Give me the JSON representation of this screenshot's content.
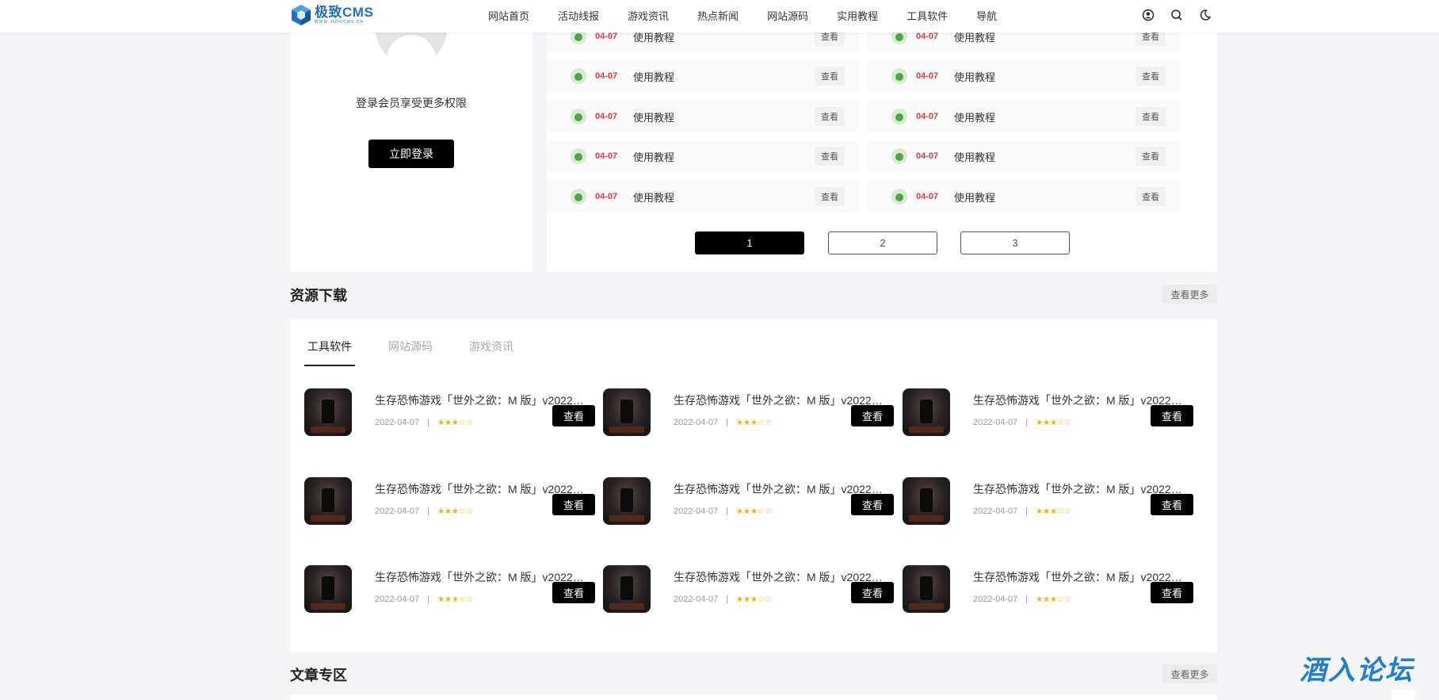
{
  "header": {
    "logo_name": "极致CMS",
    "logo_sub": "WWW.JIZHICMS.CN",
    "nav": [
      "网站首页",
      "活动线报",
      "游戏资讯",
      "热点新闻",
      "网站源码",
      "实用教程",
      "工具软件",
      "导航"
    ],
    "icons": [
      "user-icon",
      "search-icon",
      "moon-icon"
    ]
  },
  "login": {
    "text": "登录会员享受更多权限",
    "button": "立即登录"
  },
  "list": {
    "rows": [
      {
        "date": "04-07",
        "title": "使用教程",
        "view": "查看"
      },
      {
        "date": "04-07",
        "title": "使用教程",
        "view": "查看"
      },
      {
        "date": "04-07",
        "title": "使用教程",
        "view": "查看"
      },
      {
        "date": "04-07",
        "title": "使用教程",
        "view": "查看"
      },
      {
        "date": "04-07",
        "title": "使用教程",
        "view": "查看"
      },
      {
        "date": "04-07",
        "title": "使用教程",
        "view": "查看"
      },
      {
        "date": "04-07",
        "title": "使用教程",
        "view": "查看"
      },
      {
        "date": "04-07",
        "title": "使用教程",
        "view": "查看"
      },
      {
        "date": "04-07",
        "title": "使用教程",
        "view": "查看"
      },
      {
        "date": "04-07",
        "title": "使用教程",
        "view": "查看"
      }
    ],
    "pages": [
      "1",
      "2",
      "3"
    ],
    "current_page": "1"
  },
  "resources": {
    "title": "资源下载",
    "more": "查看更多",
    "tabs": [
      "工具软件",
      "网站源码",
      "游戏资讯"
    ],
    "active_tab": "工具软件",
    "items": [
      {
        "title": "生存恐怖游戏「世外之欲：M 版」v2022021...",
        "date": "2022-04-07",
        "sep": "|",
        "stars": "★★★☆☆",
        "rating": 3,
        "button": "查看"
      },
      {
        "title": "生存恐怖游戏「世外之欲：M 版」v2022021...",
        "date": "2022-04-07",
        "sep": "|",
        "stars": "★★★☆☆",
        "rating": 3,
        "button": "查看"
      },
      {
        "title": "生存恐怖游戏「世外之欲：M 版」v2022021...",
        "date": "2022-04-07",
        "sep": "|",
        "stars": "★★★☆☆",
        "rating": 3,
        "button": "查看"
      },
      {
        "title": "生存恐怖游戏「世外之欲：M 版」v2022021...",
        "date": "2022-04-07",
        "sep": "|",
        "stars": "★★★☆☆",
        "rating": 3,
        "button": "查看"
      },
      {
        "title": "生存恐怖游戏「世外之欲：M 版」v2022021...",
        "date": "2022-04-07",
        "sep": "|",
        "stars": "★★★☆☆",
        "rating": 3,
        "button": "查看"
      },
      {
        "title": "生存恐怖游戏「世外之欲：M 版」v2022021...",
        "date": "2022-04-07",
        "sep": "|",
        "stars": "★★★☆☆",
        "rating": 3,
        "button": "查看"
      },
      {
        "title": "生存恐怖游戏「世外之欲：M 版」v2022021...",
        "date": "2022-04-07",
        "sep": "|",
        "stars": "★★★☆☆",
        "rating": 3,
        "button": "查看"
      },
      {
        "title": "生存恐怖游戏「世外之欲：M 版」v2022021...",
        "date": "2022-04-07",
        "sep": "|",
        "stars": "★★★☆☆",
        "rating": 3,
        "button": "查看"
      },
      {
        "title": "生存恐怖游戏「世外之欲：M 版」v2022021...",
        "date": "2022-04-07",
        "sep": "|",
        "stars": "★★★☆☆",
        "rating": 3,
        "button": "查看"
      }
    ]
  },
  "articles": {
    "title": "文章专区",
    "more": "查看更多"
  },
  "watermark": "酒入论坛",
  "colors": {
    "brand": "#1f6fc6",
    "date_red": "#e0393e",
    "star": "#f0b400",
    "page_bg": "#f5f5f8"
  }
}
